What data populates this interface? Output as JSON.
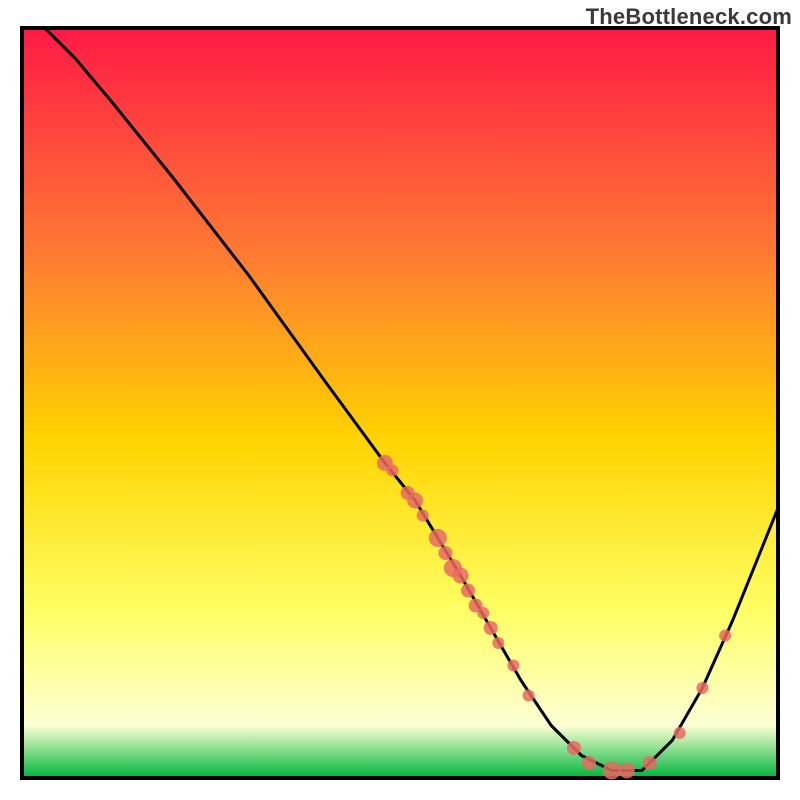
{
  "watermark": "TheBottleneck.com",
  "colors": {
    "gradient_top": "#ff1a45",
    "gradient_mid1": "#ff7a33",
    "gradient_mid2": "#ffd400",
    "gradient_mid3": "#ffff66",
    "gradient_mid4": "#fdffd4",
    "gradient_bottom": "#00b43c",
    "curve": "#000000",
    "dot_fill": "#e86a63",
    "dot_stroke": "#b94e48",
    "frame": "#000000"
  },
  "chart_data": {
    "type": "line",
    "title": "",
    "xlabel": "",
    "ylabel": "",
    "xlim": [
      0,
      100
    ],
    "ylim": [
      0,
      100
    ],
    "grid": false,
    "curve": [
      {
        "x": 3,
        "y": 100
      },
      {
        "x": 7,
        "y": 96
      },
      {
        "x": 12,
        "y": 90
      },
      {
        "x": 20,
        "y": 80
      },
      {
        "x": 30,
        "y": 67
      },
      {
        "x": 40,
        "y": 53
      },
      {
        "x": 48,
        "y": 42
      },
      {
        "x": 52,
        "y": 37
      },
      {
        "x": 55,
        "y": 32
      },
      {
        "x": 58,
        "y": 27
      },
      {
        "x": 62,
        "y": 20
      },
      {
        "x": 66,
        "y": 13
      },
      {
        "x": 70,
        "y": 7
      },
      {
        "x": 74,
        "y": 3
      },
      {
        "x": 78,
        "y": 1
      },
      {
        "x": 82,
        "y": 1
      },
      {
        "x": 86,
        "y": 5
      },
      {
        "x": 90,
        "y": 12
      },
      {
        "x": 94,
        "y": 21
      },
      {
        "x": 98,
        "y": 31
      },
      {
        "x": 100,
        "y": 36
      }
    ],
    "points": [
      {
        "x": 48,
        "y": 42,
        "r": 8
      },
      {
        "x": 49,
        "y": 41,
        "r": 6
      },
      {
        "x": 51,
        "y": 38,
        "r": 7
      },
      {
        "x": 52,
        "y": 37,
        "r": 8
      },
      {
        "x": 53,
        "y": 35,
        "r": 6
      },
      {
        "x": 55,
        "y": 32,
        "r": 9
      },
      {
        "x": 56,
        "y": 30,
        "r": 7
      },
      {
        "x": 57,
        "y": 28,
        "r": 9
      },
      {
        "x": 58,
        "y": 27,
        "r": 8
      },
      {
        "x": 59,
        "y": 25,
        "r": 7
      },
      {
        "x": 60,
        "y": 23,
        "r": 7
      },
      {
        "x": 61,
        "y": 22,
        "r": 6
      },
      {
        "x": 62,
        "y": 20,
        "r": 7
      },
      {
        "x": 63,
        "y": 18,
        "r": 6
      },
      {
        "x": 65,
        "y": 15,
        "r": 6
      },
      {
        "x": 67,
        "y": 11,
        "r": 6
      },
      {
        "x": 73,
        "y": 4,
        "r": 7
      },
      {
        "x": 75,
        "y": 2,
        "r": 7
      },
      {
        "x": 78,
        "y": 1,
        "r": 9
      },
      {
        "x": 80,
        "y": 1,
        "r": 8
      },
      {
        "x": 83,
        "y": 2,
        "r": 7
      },
      {
        "x": 87,
        "y": 6,
        "r": 6
      },
      {
        "x": 90,
        "y": 12,
        "r": 6
      },
      {
        "x": 93,
        "y": 19,
        "r": 6
      }
    ]
  }
}
